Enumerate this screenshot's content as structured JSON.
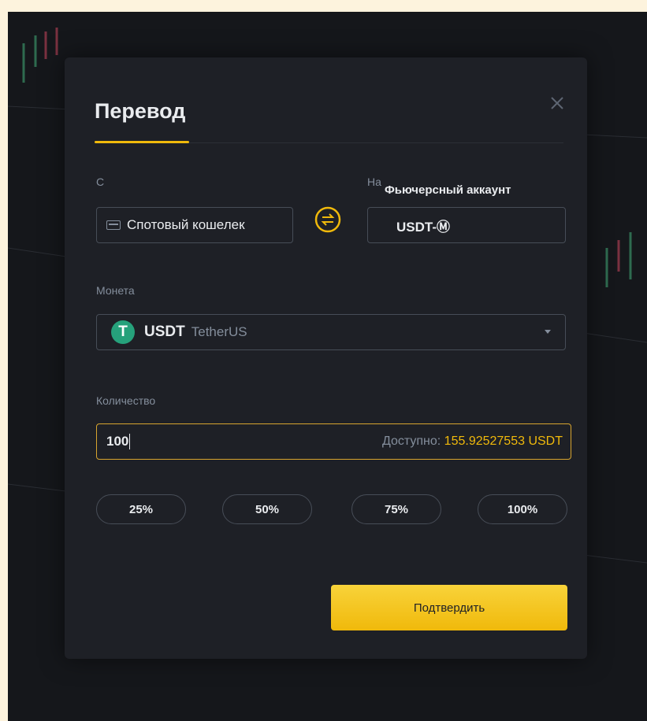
{
  "modal": {
    "title": "Перевод",
    "close_icon": "close-icon"
  },
  "from": {
    "label": "С",
    "value": "Спотовый кошелек",
    "icon": "wallet-icon"
  },
  "swap_icon": "swap-arrows-icon",
  "to": {
    "label": "На",
    "title": "Фьючерсный аккаунт",
    "value": "USDT-Ⓜ"
  },
  "coin": {
    "label": "Монета",
    "symbol": "USDT",
    "name": "TetherUS",
    "icon_glyph": "T",
    "icon": "tether-icon"
  },
  "amount": {
    "label": "Количество",
    "value": "100",
    "available_label": "Доступно: ",
    "available_value": "155.92527553 USDT"
  },
  "percent_buttons": [
    "25%",
    "50%",
    "75%",
    "100%"
  ],
  "confirm_label": "Подтвердить",
  "colors": {
    "accent": "#f0b90b",
    "background": "#1e2026",
    "text": "#eaecef",
    "muted": "#848e9c"
  }
}
